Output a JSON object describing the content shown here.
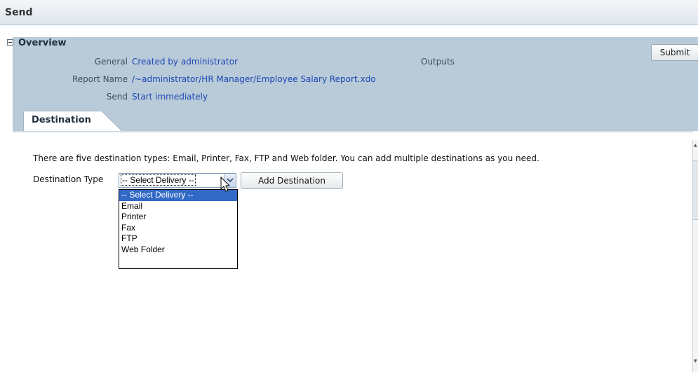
{
  "header": {
    "title": "Send"
  },
  "overview": {
    "title": "Overview",
    "fields": [
      {
        "label": "General",
        "value": "Created by administrator"
      },
      {
        "label": "Report Name",
        "value": "/~administrator/HR Manager/Employee Salary Report.xdo"
      },
      {
        "label": "Send",
        "value": "Start immediately"
      }
    ],
    "outputs_label": "Outputs",
    "submit_label": "Submit"
  },
  "tabs": [
    {
      "label": "Destination",
      "active": true
    }
  ],
  "destination": {
    "description": "There are five destination types: Email, Printer, Fax, FTP and Web folder. You can add multiple destinations as you need.",
    "type_label": "Destination Type",
    "selected": "-- Select Delivery --",
    "options": [
      "-- Select Delivery --",
      "Email",
      "Printer",
      "Fax",
      "FTP",
      "Web Folder"
    ],
    "add_button": "Add Destination"
  },
  "colors": {
    "panel": "#b9cad8",
    "link": "#1b48b5",
    "selection": "#3169c6"
  }
}
